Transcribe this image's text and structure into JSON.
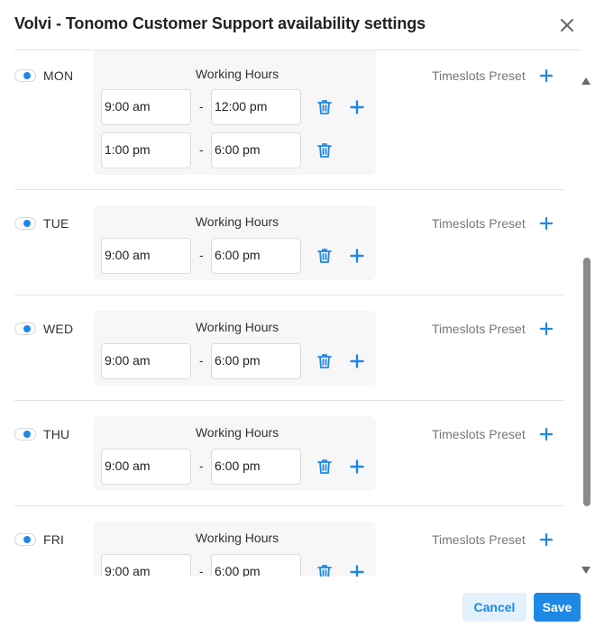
{
  "dialog": {
    "title": "Volvi - Tonomo Customer Support availability settings"
  },
  "labels": {
    "working_hours": "Working Hours",
    "timeslots_preset": "Timeslots Preset",
    "dash": "-"
  },
  "days": [
    {
      "label": "MON",
      "enabled": true,
      "slots": [
        {
          "start": "9:00 am",
          "end": "12:00 pm"
        },
        {
          "start": "1:00 pm",
          "end": "6:00 pm"
        }
      ]
    },
    {
      "label": "TUE",
      "enabled": true,
      "slots": [
        {
          "start": "9:00 am",
          "end": "6:00 pm"
        }
      ]
    },
    {
      "label": "WED",
      "enabled": true,
      "slots": [
        {
          "start": "9:00 am",
          "end": "6:00 pm"
        }
      ]
    },
    {
      "label": "THU",
      "enabled": true,
      "slots": [
        {
          "start": "9:00 am",
          "end": "6:00 pm"
        }
      ]
    },
    {
      "label": "FRI",
      "enabled": true,
      "slots": [
        {
          "start": "9:00 am",
          "end": "6:00 pm"
        }
      ]
    }
  ],
  "footer": {
    "cancel_label": "Cancel",
    "save_label": "Save"
  },
  "colors": {
    "accent": "#1e88e5",
    "accent_light": "#e3f1fd",
    "card_bg": "#f7f7f7"
  },
  "icons": {
    "close": "close-icon",
    "delete": "trash-icon",
    "add": "plus-icon",
    "scroll_up": "triangle-up-icon",
    "scroll_down": "triangle-down-icon"
  }
}
